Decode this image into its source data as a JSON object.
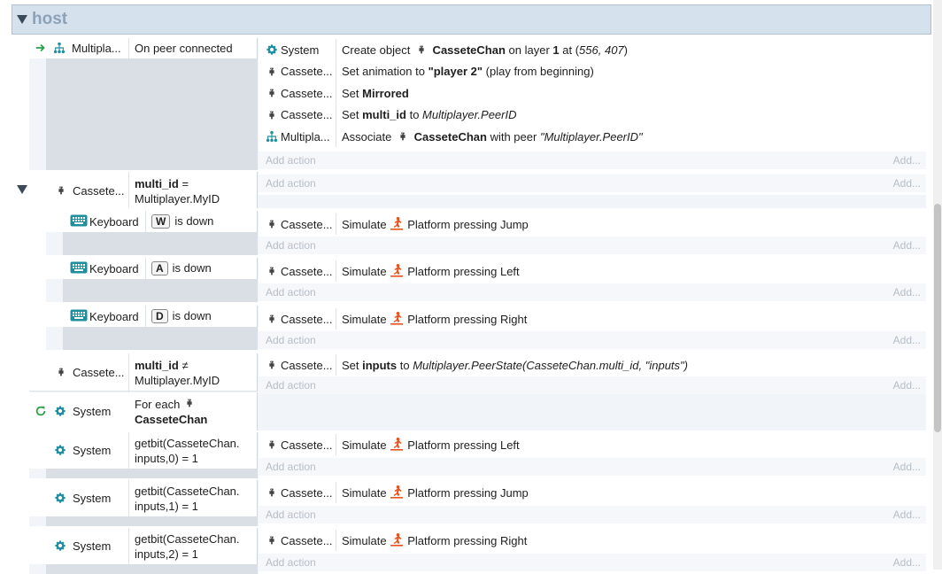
{
  "group": {
    "title": "host"
  },
  "add_action": "Add action",
  "add_more": "Add...",
  "events": {
    "e1": {
      "cond": {
        "object": "Multiplа...",
        "text": "On peer connected"
      },
      "actions": [
        {
          "object": "System",
          "parts": [
            [
              "Create object "
            ],
            [
              "",
              "",
              "ghost"
            ],
            [
              " CasseteChan",
              "b"
            ],
            [
              " on layer "
            ],
            [
              "1",
              "b"
            ],
            [
              " at ("
            ],
            [
              "556, 407",
              "i"
            ],
            [
              ")"
            ]
          ]
        },
        {
          "object": "Cassete...",
          "parts": [
            [
              "Set animation to "
            ],
            [
              "\"player 2\"",
              "b"
            ],
            [
              " (play from beginning)"
            ]
          ]
        },
        {
          "object": "Cassete...",
          "parts": [
            [
              "Set "
            ],
            [
              "Mirrored",
              "b"
            ]
          ]
        },
        {
          "object": "Cassete...",
          "parts": [
            [
              "Set "
            ],
            [
              "multi_id",
              "b"
            ],
            [
              " to "
            ],
            [
              "Multiplayer.PeerID",
              "i"
            ]
          ]
        },
        {
          "object": "Multipla...",
          "parts": [
            [
              "Associate "
            ],
            [
              "",
              "",
              "ghost"
            ],
            [
              " CasseteChan",
              "b"
            ],
            [
              " with peer "
            ],
            [
              "\"Multiplayer.PeerID\"",
              "i"
            ]
          ]
        }
      ]
    },
    "e2": {
      "cond": {
        "object": "Cassete...",
        "line1": "multi_id",
        "line1b": " =",
        "line2": "Multiplayer.MyID"
      }
    },
    "e3": {
      "cond": {
        "object": "Keyboard",
        "key": "W",
        "text": "is down"
      },
      "action": {
        "object": "Cassete...",
        "pre": "Simulate ",
        "behavior": "Platform",
        "post": " pressing Jump"
      }
    },
    "e4": {
      "cond": {
        "object": "Keyboard",
        "key": "A",
        "text": "is down"
      },
      "action": {
        "object": "Cassete...",
        "pre": "Simulate ",
        "behavior": "Platform",
        "post": " pressing Left"
      }
    },
    "e5": {
      "cond": {
        "object": "Keyboard",
        "key": "D",
        "text": "is down"
      },
      "action": {
        "object": "Cassete...",
        "pre": "Simulate ",
        "behavior": "Platform",
        "post": " pressing Right"
      }
    },
    "e6": {
      "cond1": {
        "object": "Cassete...",
        "line1": "multi_id",
        "line1b": " ≠",
        "line2": "Multiplayer.MyID"
      },
      "cond2": {
        "object": "System",
        "line1": "For each",
        "line2": "CasseteChan"
      },
      "action": {
        "object": "Cassete...",
        "parts": [
          [
            "Set "
          ],
          [
            "inputs",
            "b"
          ],
          [
            " to "
          ],
          [
            "Multiplayer.PeerState(CasseteChan.multi_id, \"inputs\")",
            "i"
          ]
        ]
      }
    },
    "e7": {
      "cond": {
        "object": "System",
        "line1": "getbit(CasseteChan.",
        "line2": "inputs,0) = 1"
      },
      "action": {
        "object": "Cassete...",
        "pre": "Simulate ",
        "behavior": "Platform",
        "post": " pressing Left"
      }
    },
    "e8": {
      "cond": {
        "object": "System",
        "line1": "getbit(CasseteChan.",
        "line2": "inputs,1) = 1"
      },
      "action": {
        "object": "Cassete...",
        "pre": "Simulate ",
        "behavior": "Platform",
        "post": " pressing Jump"
      }
    },
    "e9": {
      "cond": {
        "object": "System",
        "line1": "getbit(CasseteChan.",
        "line2": "inputs,2) = 1"
      },
      "action": {
        "object": "Cassete...",
        "pre": "Simulate ",
        "behavior": "Platform",
        "post": " pressing Right"
      }
    }
  },
  "colors": {
    "group_bg": "#d6e1ee",
    "group_title": "#8ba2b8",
    "event_bg": "#f1f5f9",
    "teal": "#1f8fa0",
    "orange": "#e8521c",
    "green": "#2aa04a"
  }
}
